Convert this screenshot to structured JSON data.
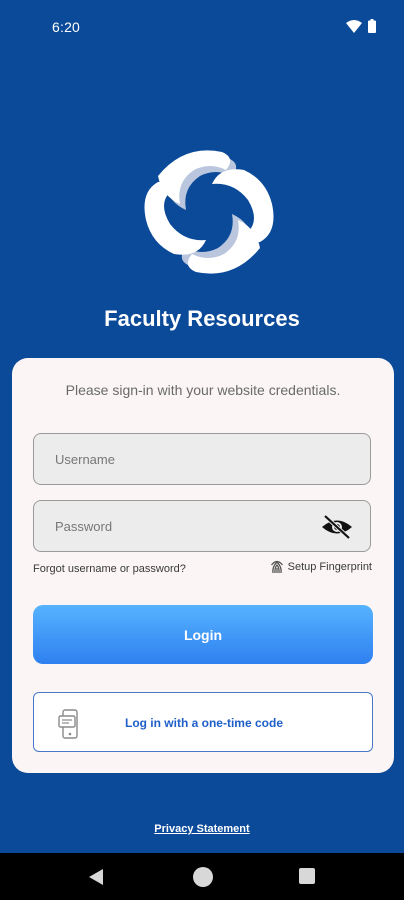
{
  "status_bar": {
    "time": "6:20"
  },
  "app": {
    "title": "Faculty Resources"
  },
  "login_card": {
    "subtitle": "Please sign-in with your website credentials.",
    "username_placeholder": "Username",
    "password_placeholder": "Password",
    "forgot_link": "Forgot username or password?",
    "fingerprint_label": "Setup Fingerprint",
    "login_button": "Login",
    "otp_button": "Log in with a one-time code"
  },
  "footer": {
    "privacy_link": "Privacy Statement"
  },
  "colors": {
    "background": "#0b4a99",
    "card": "#fbf5f5",
    "button_gradient_top": "#56b3ff",
    "button_gradient_bottom": "#2f80f0",
    "otp_text": "#1f5fc9"
  }
}
